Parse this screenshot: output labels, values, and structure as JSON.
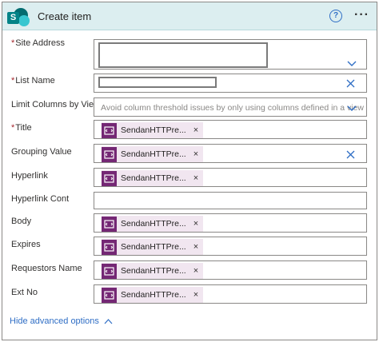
{
  "header": {
    "app_icon": "sharepoint-logo",
    "app_icon_letter": "S",
    "title": "Create item",
    "help_icon": "question-circle-icon",
    "help_glyph": "?",
    "more_icon": "ellipsis-icon",
    "more_glyph": "···",
    "bg_color": "#dceef0"
  },
  "fields": {
    "site_address": {
      "label": "Site Address",
      "required": "*"
    },
    "list_name": {
      "label": "List Name",
      "required": "*"
    },
    "limit_columns": {
      "label": "Limit Columns by View",
      "placeholder": "Avoid column threshold issues by only using columns defined in a view"
    },
    "title": {
      "label": "Title",
      "required": "*",
      "token": "SendanHTTPre..."
    },
    "grouping_value": {
      "label": "Grouping Value",
      "token": "SendanHTTPre..."
    },
    "hyperlink": {
      "label": "Hyperlink",
      "token": "SendanHTTPre..."
    },
    "hyperlink_cont": {
      "label": "Hyperlink Cont"
    },
    "body": {
      "label": "Body",
      "token": "SendanHTTPre..."
    },
    "expires": {
      "label": "Expires",
      "token": "SendanHTTPre..."
    },
    "requestors_name": {
      "label": "Requestors Name",
      "token": "SendanHTTPre..."
    },
    "ext_no": {
      "label": "Ext No",
      "token": "SendanHTTPre..."
    }
  },
  "token_remove_glyph": "×",
  "footer": {
    "hide_advanced": "Hide advanced options"
  },
  "colors": {
    "accent": "#2f6ec5",
    "token_bg": "#f1e6f0",
    "token_icon": "#742774",
    "required": "#a4262c"
  }
}
